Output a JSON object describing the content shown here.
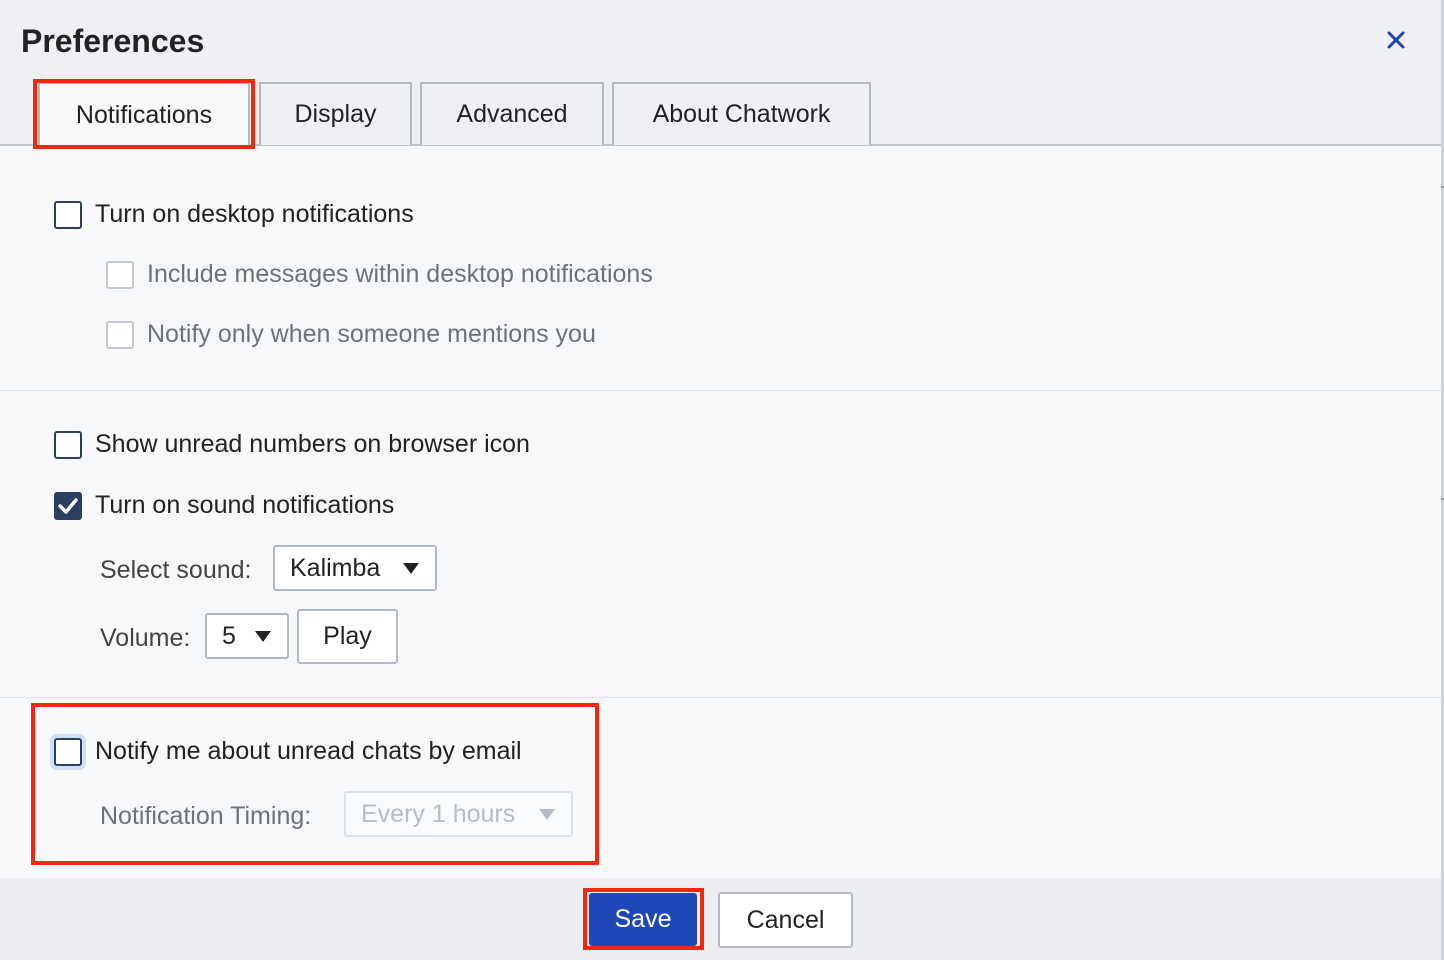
{
  "dialog": {
    "title": "Preferences"
  },
  "tabs": [
    {
      "label": "Notifications"
    },
    {
      "label": "Display"
    },
    {
      "label": "Advanced"
    },
    {
      "label": "About Chatwork"
    }
  ],
  "desktop": {
    "turn_on_label": "Turn on desktop notifications",
    "include_messages_label": "Include messages within desktop notifications",
    "mentions_only_label": "Notify only when someone mentions you"
  },
  "browser": {
    "unread_numbers_label": "Show unread numbers on browser icon",
    "sound_label": "Turn on sound notifications",
    "select_sound_label": "Select sound:",
    "sound_value": "Kalimba",
    "volume_label": "Volume:",
    "volume_value": "5",
    "play_label": "Play"
  },
  "email": {
    "notify_label": "Notify me about unread chats by email",
    "timing_label": "Notification Timing:",
    "timing_value": "Every 1 hours"
  },
  "footer": {
    "save_label": "Save",
    "cancel_label": "Cancel"
  },
  "colors": {
    "highlight": "#f0280f",
    "primary": "#1f47b7",
    "checkbox": "#2d3e63"
  },
  "icons": {
    "close": "close-icon",
    "check": "checkmark-icon",
    "dropdown": "chevron-down-icon"
  }
}
